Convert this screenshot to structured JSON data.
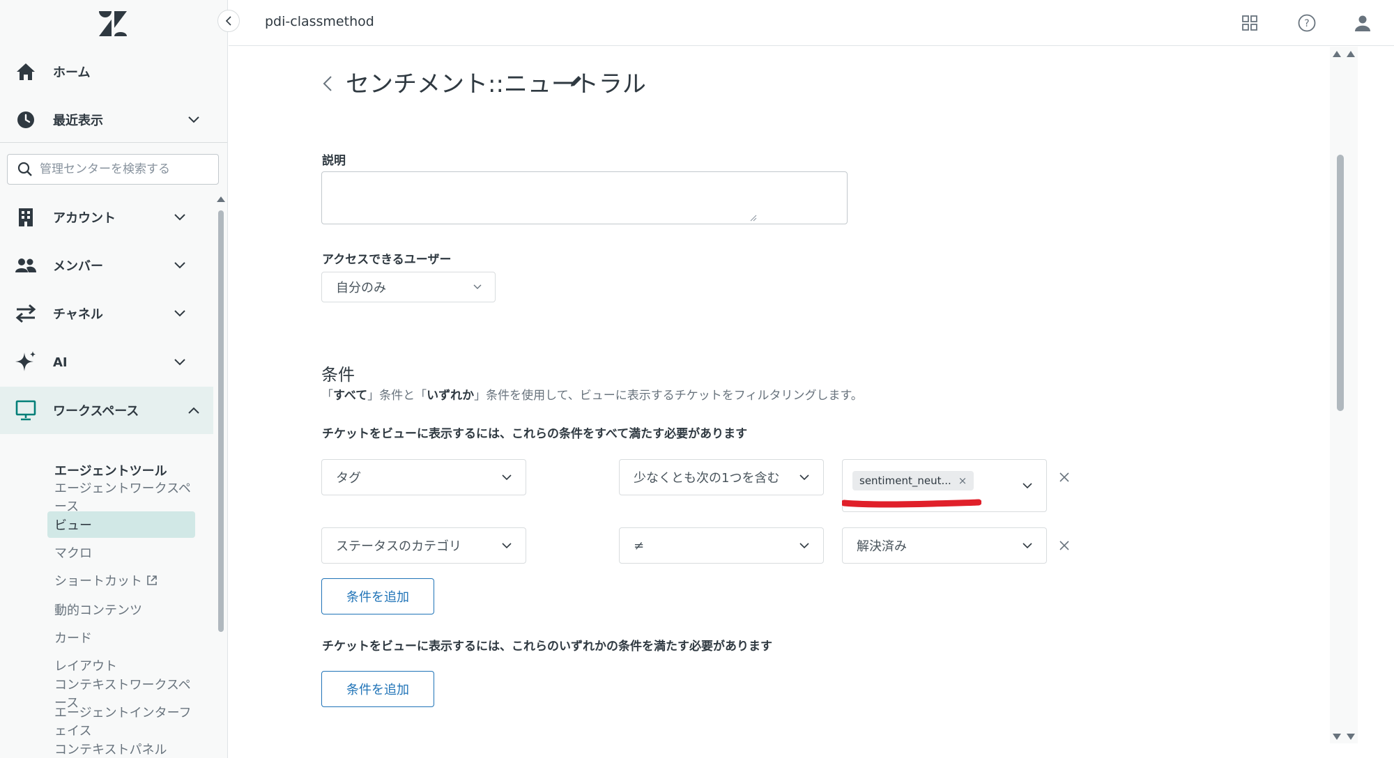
{
  "brand": {
    "logo_icon": "zendesk-logo-icon"
  },
  "sidebar": {
    "nav": [
      {
        "label": "ホーム",
        "icon": "home-icon"
      },
      {
        "label": "最近表示",
        "icon": "clock-icon"
      },
      {
        "label": "アカウント",
        "icon": "building-icon"
      },
      {
        "label": "メンバー",
        "icon": "people-icon"
      },
      {
        "label": "チャネル",
        "icon": "arrows-icon"
      },
      {
        "label": "AI",
        "icon": "sparkle-icon"
      },
      {
        "label": "ワークスペース",
        "icon": "monitor-icon"
      }
    ],
    "search": {
      "placeholder": "管理センターを検索する"
    },
    "sub_heading": "エージェントツール",
    "sub_items": [
      "エージェントワークスペース",
      "ビュー",
      "マクロ",
      "ショートカット",
      "動的コンテンツ",
      "カード",
      "レイアウト",
      "コンテキストワークスペース",
      "エージェントインターフェイス",
      "コンテキストパネル"
    ],
    "active_sub_item": "ビュー"
  },
  "topbar": {
    "org_name": "pdi-classmethod",
    "icons": [
      "apps-grid-icon",
      "help-icon",
      "user-avatar-icon"
    ]
  },
  "main": {
    "title": "センチメント::ニュートラル",
    "description_label": "説明",
    "description_value": "",
    "access_label": "アクセスできるユーザー",
    "access_value": "自分のみ",
    "conditions": {
      "title": "条件",
      "desc_part1": "「",
      "desc_all": "すべて",
      "desc_part2": "」条件と「",
      "desc_any": "いずれか",
      "desc_part3": "」条件を使用して、ビューに表示するチケットをフィルタリングします。",
      "all_heading": "チケットをビューに表示するには、これらの条件をすべて満たす必要があります",
      "all_rows": [
        {
          "field": "タグ",
          "operator": "少なくとも次の1つを含む",
          "value_tag": "sentiment_neut..."
        },
        {
          "field": "ステータスのカテゴリ",
          "operator": "≠",
          "value": "解決済み"
        }
      ],
      "any_heading": "チケットをビューに表示するには、これらのいずれかの条件を満たす必要があります",
      "add_label": "条件を追加"
    }
  },
  "colors": {
    "accent": "#1f73b7",
    "active_bg": "#d1e8e6",
    "annotation_red": "#e0202a"
  }
}
